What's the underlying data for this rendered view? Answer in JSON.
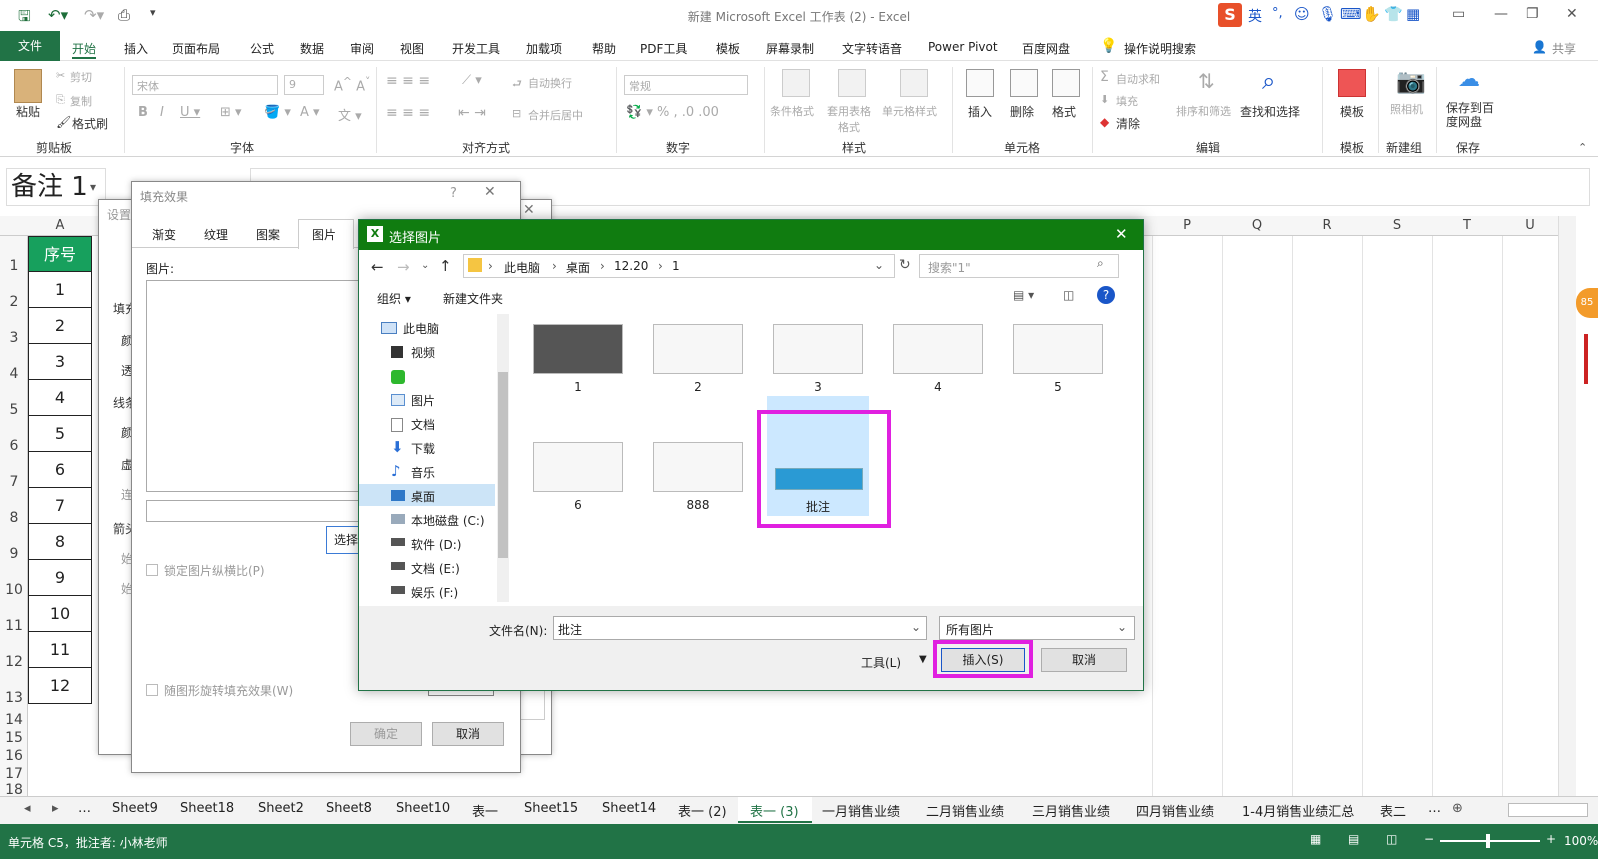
{
  "title": "新建 Microsoft Excel 工作表 (2)  -  Excel",
  "share": "共享",
  "ime": {
    "lang": "英",
    "punct": "°,"
  },
  "tabs": [
    "文件",
    "开始",
    "插入",
    "页面布局",
    "公式",
    "数据",
    "审阅",
    "视图",
    "开发工具",
    "加载项",
    "帮助",
    "PDF工具",
    "模板",
    "屏幕录制",
    "文字转语音",
    "Power Pivot",
    "百度网盘",
    "操作说明搜索"
  ],
  "ribbon": {
    "clipboard": {
      "paste": "粘贴",
      "cut": "剪切",
      "copy": "复制",
      "format_painter": "格式刷",
      "label": "剪贴板"
    },
    "font": {
      "font_name": "宋体",
      "font_size": "9",
      "label": "字体"
    },
    "align": {
      "wrap": "自动换行",
      "merge": "合并后居中",
      "label": "对齐方式"
    },
    "number": {
      "format": "常规",
      "label": "数字"
    },
    "styles": {
      "cond": "条件格式",
      "table": "套用表格格式",
      "cell": "单元格样式",
      "label": "样式"
    },
    "cells": {
      "insert": "插入",
      "delete": "删除",
      "format": "格式",
      "label": "单元格"
    },
    "edit": {
      "autosum": "自动求和",
      "fill": "填充",
      "clear": "清除",
      "sort": "排序和筛选",
      "find": "查找和选择",
      "label": "编辑"
    },
    "template": {
      "btn": "模板",
      "label": "模板"
    },
    "newgroup": {
      "btn": "照相机",
      "label": "新建组"
    },
    "save": {
      "btn": "保存到百度网盘",
      "label": "保存"
    }
  },
  "namebox": "备注 1",
  "columns": [
    "A",
    "P",
    "Q",
    "R",
    "S",
    "T",
    "U"
  ],
  "rows": [
    "1",
    "2",
    "3",
    "4",
    "5",
    "6",
    "7",
    "8",
    "9",
    "10",
    "11",
    "12",
    "13",
    "14",
    "15",
    "16",
    "17",
    "18"
  ],
  "colA": {
    "header": "序号",
    "values": [
      "1",
      "2",
      "3",
      "4",
      "5",
      "6",
      "7",
      "8",
      "9",
      "10",
      "11",
      "12"
    ]
  },
  "fill_dialog": {
    "title": "填充效果",
    "tabs": [
      "渐变",
      "纹理",
      "图案",
      "图片"
    ],
    "picture_label": "图片:",
    "select_btn": "选择",
    "lock_ratio": "锁定图片纵横比(P)",
    "rotate": "随图形旋转填充效果(W)",
    "ok": "确定",
    "cancel": "取消"
  },
  "settings_dialog": {
    "title": "设置",
    "labels": [
      "填充",
      "颜",
      "透",
      "线条",
      "颜",
      "虚",
      "连",
      "箭头",
      "始",
      "始"
    ]
  },
  "picture_dialog": {
    "title": "选择图片",
    "breadcrumb": [
      "此电脑",
      "桌面",
      "12.20",
      "1"
    ],
    "search_placeholder": "搜索\"1\"",
    "organize": "组织 ▾",
    "new_folder": "新建文件夹",
    "nav": [
      "此电脑",
      "视频",
      "",
      "图片",
      "文档",
      "下载",
      "音乐",
      "桌面",
      "本地磁盘 (C:)",
      "软件 (D:)",
      "文档 (E:)",
      "娱乐 (F:)"
    ],
    "files": [
      "1",
      "2",
      "3",
      "4",
      "5",
      "6",
      "888",
      "批注"
    ],
    "filename_label": "文件名(N):",
    "filename": "批注",
    "filetype": "所有图片",
    "tools": "工具(L)",
    "insert": "插入(S)",
    "cancel": "取消"
  },
  "sheets": [
    "Sheet9",
    "Sheet18",
    "Sheet2",
    "Sheet8",
    "Sheet10",
    "表一",
    "Sheet15",
    "Sheet14",
    "表一 (2)",
    "表一 (3)",
    "一月销售业绩",
    "二月销售业绩",
    "三月销售业绩",
    "四月销售业绩",
    "1-4月销售业绩汇总",
    "表二"
  ],
  "active_sheet": "表一 (3)",
  "status": {
    "left": "单元格 C5，批注者: 小林老师",
    "zoom": "100%"
  },
  "colors": {
    "excel_green": "#217346",
    "dialog_green": "#107c10",
    "highlight": "#e020e0"
  }
}
